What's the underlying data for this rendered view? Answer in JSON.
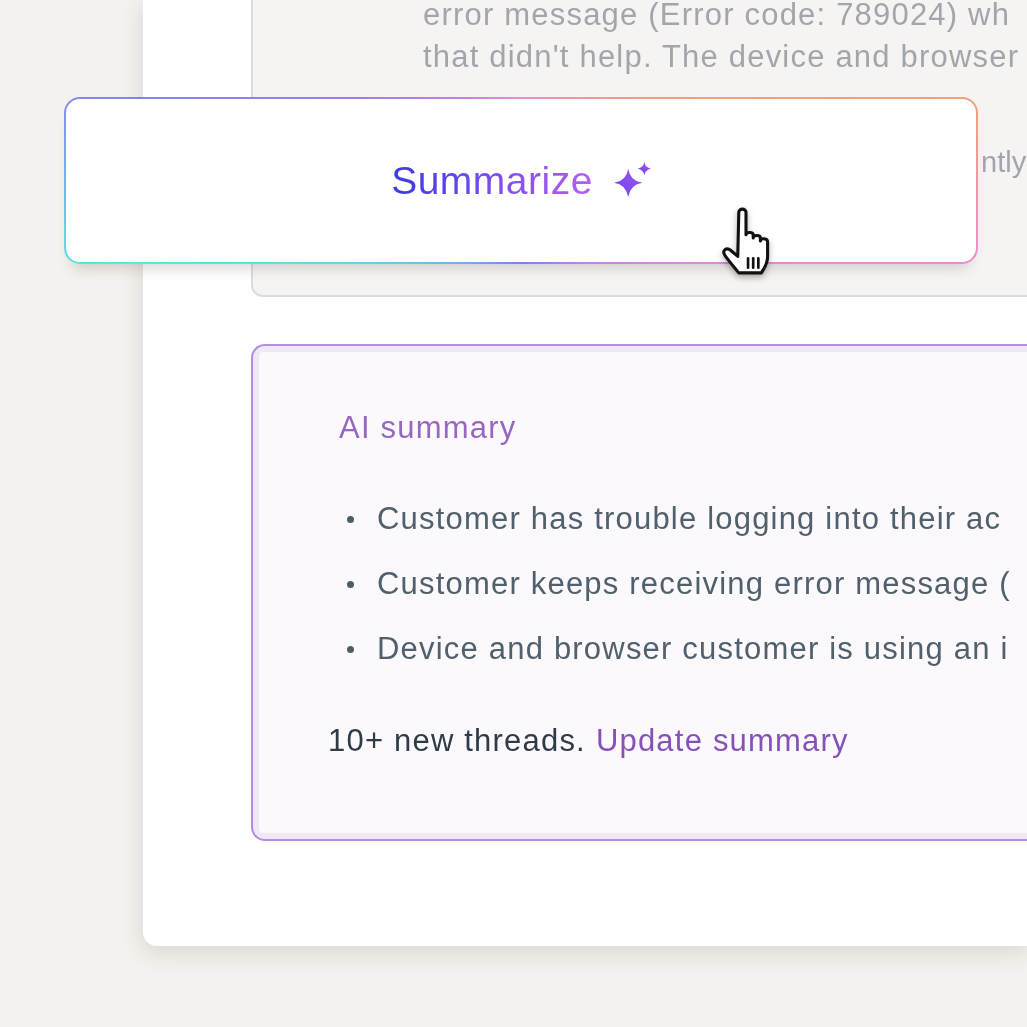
{
  "message": {
    "lines": [
      "error message (Error code: 789024) wh",
      "that didn't help. The device and browser"
    ],
    "partly_covered_line": "ntly"
  },
  "summarize_button": {
    "label": "Summarize"
  },
  "ai_summary": {
    "title": "AI summary",
    "bullets": [
      "Customer has trouble logging into their ac",
      "Customer keeps receiving error message (",
      "Device and browser customer is using an i"
    ],
    "footer": {
      "text": "10+ new threads.",
      "link": "Update summary"
    }
  }
}
